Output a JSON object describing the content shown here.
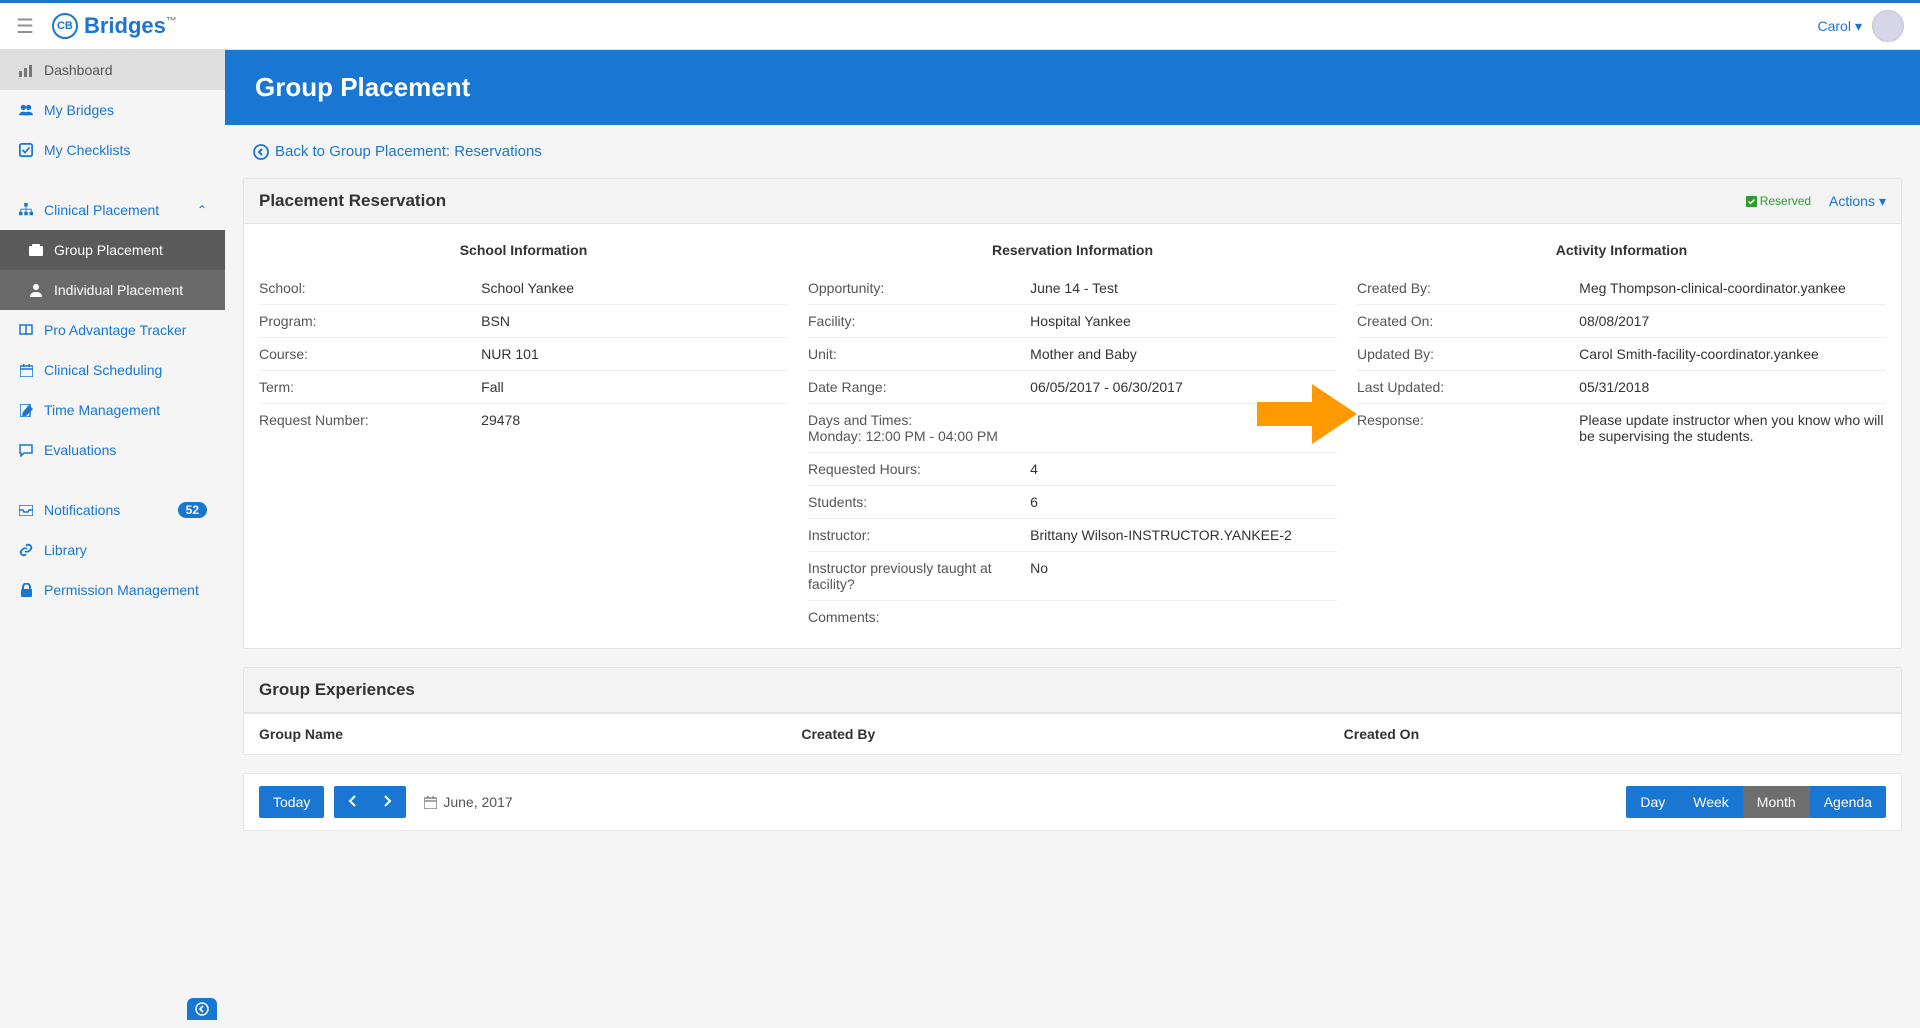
{
  "header": {
    "brand_logo_text": "CB",
    "brand_name": "Bridges",
    "brand_tm": "™",
    "user_name": "Carol"
  },
  "sidebar": {
    "dashboard": "Dashboard",
    "my_bridges": "My Bridges",
    "my_checklists": "My Checklists",
    "clinical_placement": "Clinical Placement",
    "group_placement": "Group Placement",
    "individual_placement": "Individual Placement",
    "pro_advantage": "Pro Advantage Tracker",
    "clinical_scheduling": "Clinical Scheduling",
    "time_management": "Time Management",
    "evaluations": "Evaluations",
    "notifications": "Notifications",
    "notifications_badge": "52",
    "library": "Library",
    "permission_management": "Permission Management"
  },
  "page": {
    "title": "Group Placement",
    "back_link": "Back to Group Placement: Reservations"
  },
  "reservation": {
    "panel_title": "Placement Reservation",
    "reserved_label": "Reserved",
    "actions_label": "Actions",
    "school_header": "School Information",
    "res_header": "Reservation Information",
    "activity_header": "Activity Information",
    "school": {
      "school_label": "School:",
      "school_value": "School Yankee",
      "program_label": "Program:",
      "program_value": "BSN",
      "course_label": "Course:",
      "course_value": "NUR 101",
      "term_label": "Term:",
      "term_value": "Fall",
      "reqnum_label": "Request Number:",
      "reqnum_value": "29478"
    },
    "res": {
      "opportunity_label": "Opportunity:",
      "opportunity_value": "June 14 - Test",
      "facility_label": "Facility:",
      "facility_value": "Hospital Yankee",
      "unit_label": "Unit:",
      "unit_value": "Mother and Baby",
      "daterange_label": "Date Range:",
      "daterange_value": "06/05/2017 - 06/30/2017",
      "daystimes_combined": "Days and Times:\nMonday: 12:00 PM - 04:00 PM",
      "reqhours_label": "Requested Hours:",
      "reqhours_value": "4",
      "students_label": "Students:",
      "students_value": "6",
      "instructor_label": "Instructor:",
      "instructor_value": "Brittany Wilson-INSTRUCTOR.YANKEE-2",
      "prevtaught_label": "Instructor previously taught at facility?",
      "prevtaught_value": "No",
      "comments_label": "Comments:",
      "comments_value": ""
    },
    "activity": {
      "createdby_label": "Created By:",
      "createdby_value": "Meg Thompson-clinical-coordinator.yankee",
      "createdon_label": "Created On:",
      "createdon_value": "08/08/2017",
      "updatedby_label": "Updated By:",
      "updatedby_value": "Carol Smith-facility-coordinator.yankee",
      "lastupdated_label": "Last Updated:",
      "lastupdated_value": "05/31/2018",
      "response_label": "Response:",
      "response_value": "Please update instructor when you know who will be supervising the students."
    }
  },
  "group_experiences": {
    "panel_title": "Group Experiences",
    "col_group_name": "Group Name",
    "col_created_by": "Created By",
    "col_created_on": "Created On"
  },
  "calendar": {
    "today": "Today",
    "month_label": "June, 2017",
    "view_day": "Day",
    "view_week": "Week",
    "view_month": "Month",
    "view_agenda": "Agenda"
  }
}
